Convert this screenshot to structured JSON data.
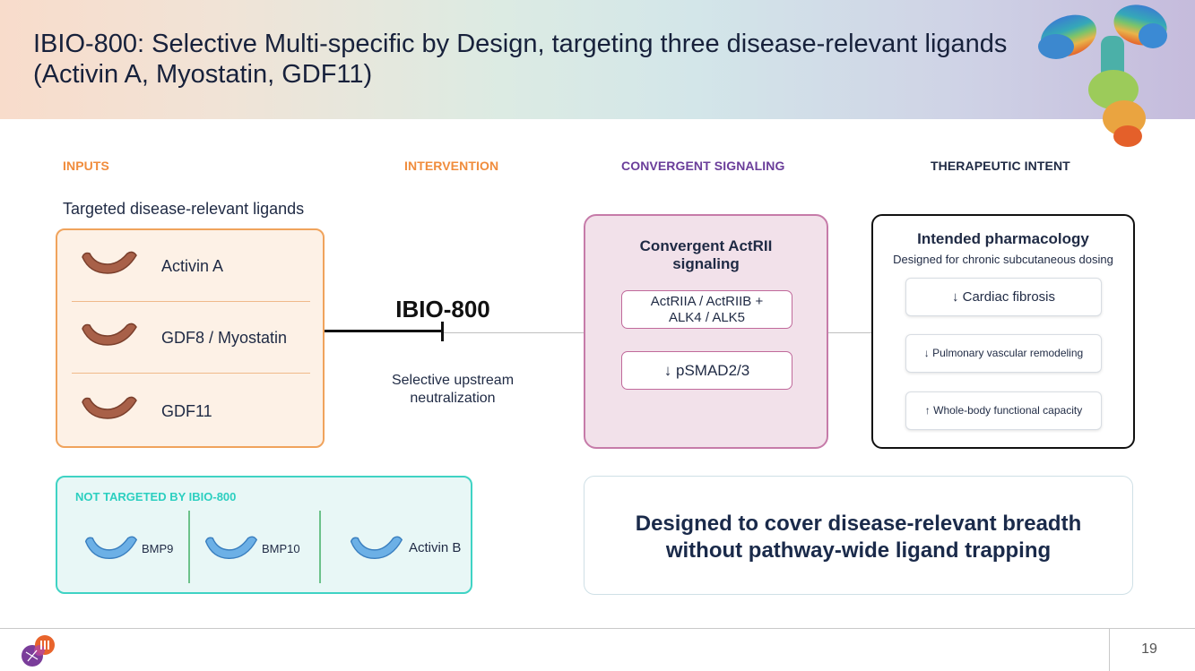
{
  "title": "IBIO-800: Selective Multi-specific by Design, targeting three disease-relevant ligands (Activin A, Myostatin, GDF11)",
  "columns": {
    "inputs": "INPUTS",
    "intervention": "INTERVENTION",
    "convergent": "CONVERGENT SIGNALING",
    "therapeutic": "THERAPEUTIC INTENT"
  },
  "column_colors": {
    "inputs": "#f08c3c",
    "intervention": "#f08c3c",
    "convergent": "#6a3d9a",
    "therapeutic": "#1f2a44"
  },
  "inputs": {
    "subtitle": "Targeted disease-relevant ligands",
    "ligands": [
      "Activin A",
      "GDF8 / Myostatin",
      "GDF11"
    ],
    "ligand_color": "#a0604a"
  },
  "intervention": {
    "drug": "IBIO-800",
    "description_line1": "Selective upstream",
    "description_line2": "neutralization"
  },
  "convergent": {
    "title_line1": "Convergent ActRII",
    "title_line2": "signaling",
    "receptors_line1": "ActRIIA / ActRIIB +",
    "receptors_line2": "ALK4 / ALK5",
    "readout": "↓ pSMAD2/3"
  },
  "therapeutic": {
    "title": "Intended pharmacology",
    "subtitle": "Designed for chronic subcutaneous dosing",
    "outcomes": [
      "↓ Cardiac fibrosis",
      "↓ Pulmonary vascular remodeling",
      "↑ Whole-body functional capacity"
    ]
  },
  "not_targeted": {
    "title": "NOT TARGETED BY IBIO-800",
    "ligands": [
      "BMP9",
      "BMP10",
      "Activin B"
    ],
    "ligand_color": "#5aa6e0"
  },
  "design_statement": {
    "line1": "Designed to cover disease-relevant breadth",
    "line2": "without pathway-wide ligand trapping"
  },
  "footer": {
    "page_number": "19"
  }
}
